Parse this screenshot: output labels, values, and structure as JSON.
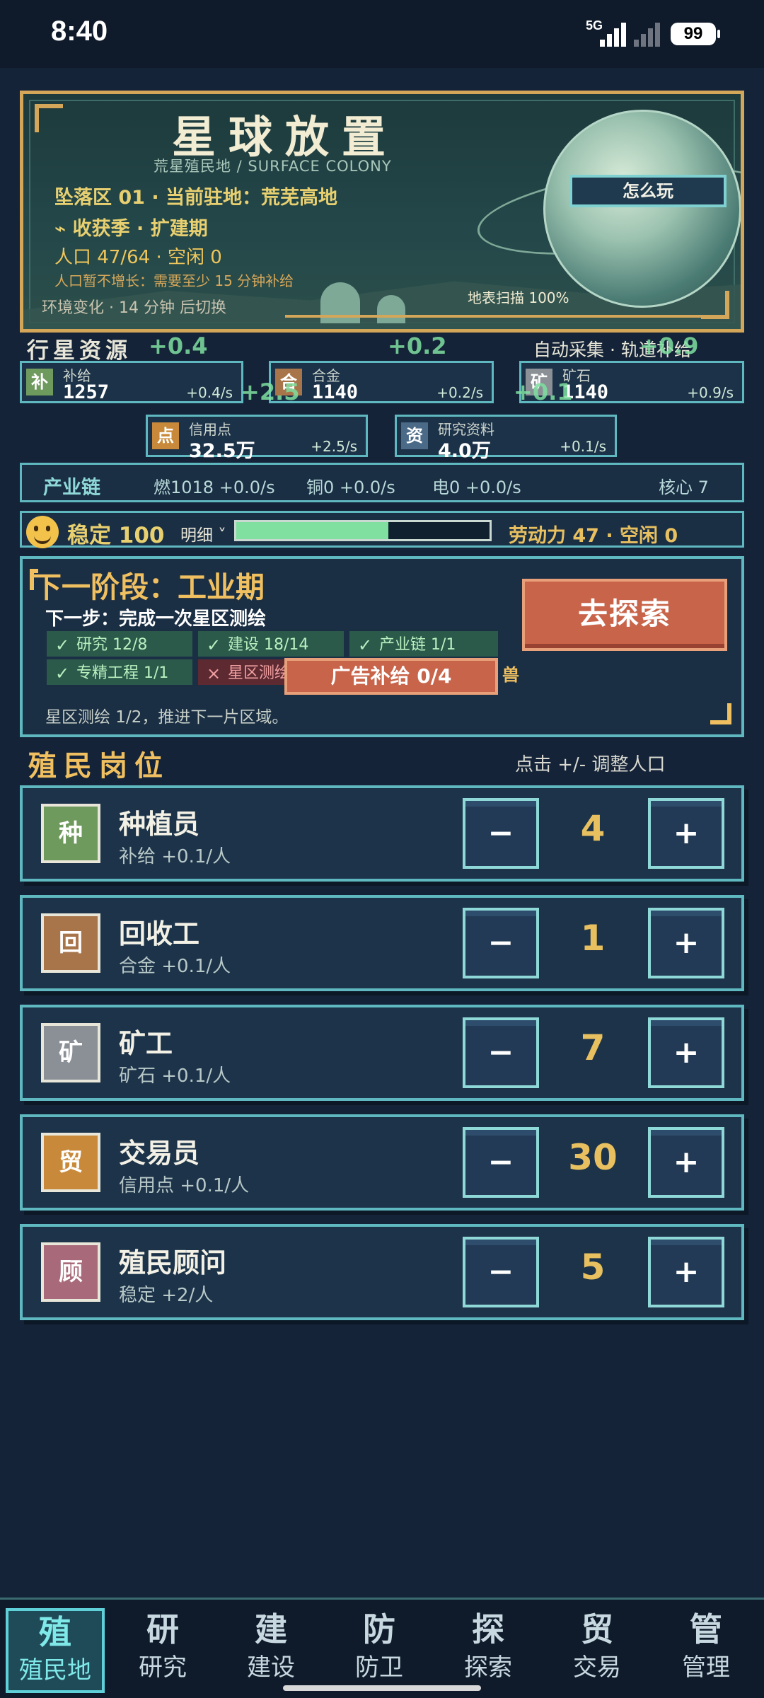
{
  "status": {
    "time": "8:40",
    "network": "5G",
    "battery": "99"
  },
  "hero": {
    "title": "星球放置",
    "subtitle": "荒星殖民地 / SURFACE COLONY",
    "location": "坠落区 01 · 当前驻地：荒芜高地",
    "season": "⌁ 收获季 · 扩建期",
    "population": "人口 47/64 · 空闲 0",
    "pop_note": "人口暂不增长：需要至少 15 分钟补给",
    "env": "环境变化 · 14 分钟 后切换",
    "scan": "地表扫描 100%",
    "howto_btn": "怎么玩"
  },
  "resources": {
    "header": "行星资源",
    "auto": "自动采集 · 轨道补给",
    "floats": [
      "+0.4",
      "+0.2",
      "+0.9",
      "+2.5",
      "+0.1"
    ],
    "items": [
      {
        "icon": "补",
        "name": "补给",
        "value": "1257",
        "rate": "+0.4/s",
        "color": "#6f9a5e"
      },
      {
        "icon": "合",
        "name": "合金",
        "value": "1140",
        "rate": "+0.2/s",
        "color": "#a8744a"
      },
      {
        "icon": "矿",
        "name": "矿石",
        "value": "1140",
        "rate": "+0.9/s",
        "color": "#8a9096"
      },
      {
        "icon": "点",
        "name": "信用点",
        "value": "32.5万",
        "rate": "+2.5/s",
        "color": "#c88a3a"
      },
      {
        "icon": "资",
        "name": "研究资料",
        "value": "4.0万",
        "rate": "+0.1/s",
        "color": "#4a6a88"
      }
    ]
  },
  "chain": {
    "label": "产业链",
    "fuel": "燃1018 +0.0/s",
    "copper": "铜0 +0.0/s",
    "power": "电0 +0.0/s",
    "core": "核心 7"
  },
  "stability": {
    "label": "稳定 100",
    "detail": "明细 ˅",
    "fill": 0.6,
    "labor": "劳动力 47 · 空闲 0"
  },
  "stage": {
    "title": "下一阶段：工业期",
    "next": "下一步：完成一次星区测绘",
    "chips": [
      {
        "mark": "✓",
        "text": "研究 12/8",
        "ok": true
      },
      {
        "mark": "✓",
        "text": "建设 18/14",
        "ok": true
      },
      {
        "mark": "✓",
        "text": "产业链 1/1",
        "ok": true
      },
      {
        "mark": "✓",
        "text": "专精工程 1/1",
        "ok": true
      },
      {
        "mark": "×",
        "text": "星区测绘",
        "ok": false
      }
    ],
    "note": "星区测绘 1/2，推进下一片区域。",
    "explore_btn": "去探索",
    "ad_btn": "广告补给 0/4",
    "behind_text": "兽"
  },
  "jobs": {
    "title": "殖民岗位",
    "hint": "点击 +/- 调整人口",
    "items": [
      {
        "icon": "种",
        "name": "种植员",
        "desc": "补给 +0.1/人",
        "count": "4",
        "color": "#6f9a5e"
      },
      {
        "icon": "回",
        "name": "回收工",
        "desc": "合金 +0.1/人",
        "count": "1",
        "color": "#a8744a"
      },
      {
        "icon": "矿",
        "name": "矿工",
        "desc": "矿石 +0.1/人",
        "count": "7",
        "color": "#8a9096"
      },
      {
        "icon": "贸",
        "name": "交易员",
        "desc": "信用点 +0.1/人",
        "count": "30",
        "color": "#c88a3a"
      },
      {
        "icon": "顾",
        "name": "殖民顾问",
        "desc": "稳定 +2/人",
        "count": "5",
        "color": "#a86a7a"
      }
    ],
    "minus": "−",
    "plus": "+"
  },
  "tabs": [
    {
      "big": "殖",
      "small": "殖民地",
      "active": true
    },
    {
      "big": "研",
      "small": "研究"
    },
    {
      "big": "建",
      "small": "建设"
    },
    {
      "big": "防",
      "small": "防卫"
    },
    {
      "big": "探",
      "small": "探索"
    },
    {
      "big": "贸",
      "small": "交易"
    },
    {
      "big": "管",
      "small": "管理"
    }
  ]
}
